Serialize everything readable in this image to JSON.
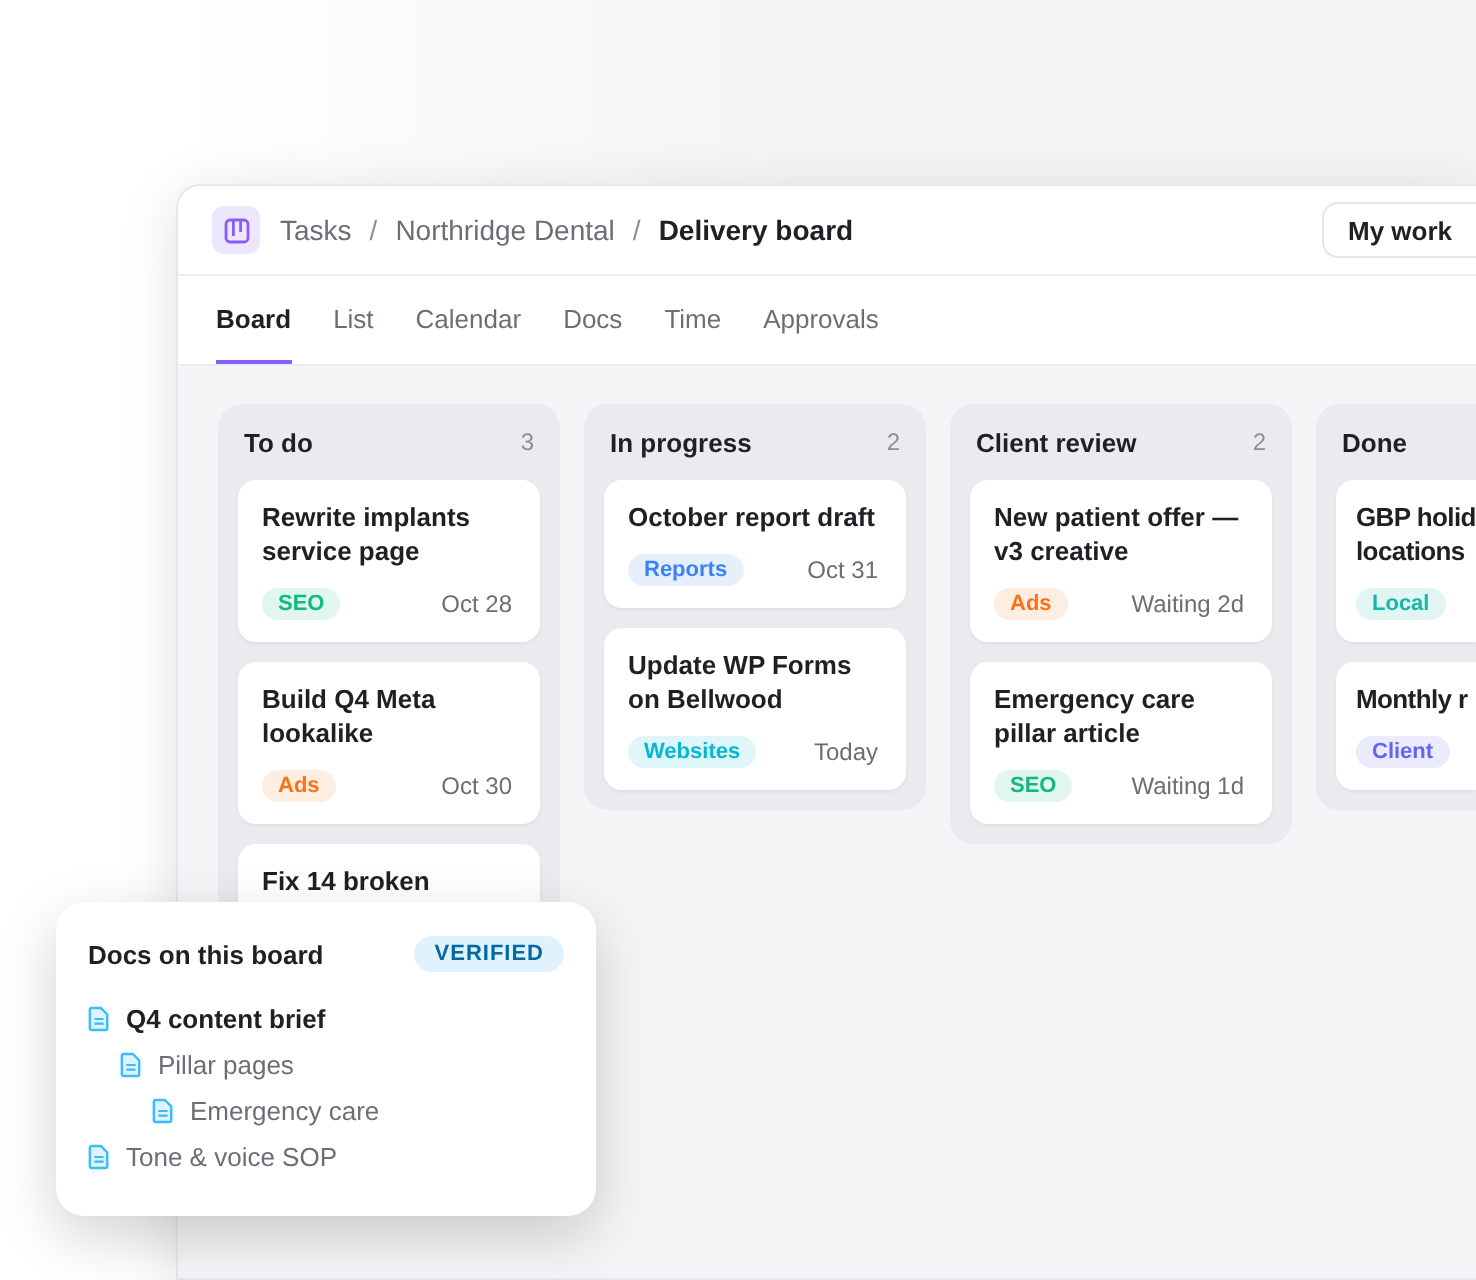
{
  "header": {
    "breadcrumb": [
      "Tasks",
      "Northridge Dental"
    ],
    "separator": "/",
    "current": "Delivery board",
    "button": "My work"
  },
  "tabs": [
    {
      "label": "Board",
      "selected": true
    },
    {
      "label": "List",
      "selected": false
    },
    {
      "label": "Calendar",
      "selected": false
    },
    {
      "label": "Docs",
      "selected": false
    },
    {
      "label": "Time",
      "selected": false
    },
    {
      "label": "Approvals",
      "selected": false
    }
  ],
  "columns": [
    {
      "title": "To do",
      "count": "3",
      "cards": [
        {
          "title": "Rewrite implants service page",
          "tag": {
            "label": "SEO",
            "color": "#10b981"
          },
          "due": "Oct 28"
        },
        {
          "title": "Build Q4 Meta lookalike",
          "tag": {
            "label": "Ads",
            "color": "#f97316"
          },
          "due": "Oct 30"
        },
        {
          "title": "Fix 14 broken"
        }
      ]
    },
    {
      "title": "In progress",
      "count": "2",
      "cards": [
        {
          "title": "October report draft",
          "tag": {
            "label": "Reports",
            "color": "#3b82f6"
          },
          "due": "Oct 31"
        },
        {
          "title": "Update WP Forms on Bellwood",
          "tag": {
            "label": "Websites",
            "color": "#06b6d4"
          },
          "due": "Today"
        }
      ]
    },
    {
      "title": "Client review",
      "count": "2",
      "cards": [
        {
          "title": "New patient offer — v3 creative",
          "tag": {
            "label": "Ads",
            "color": "#f97316"
          },
          "due": "Waiting 2d"
        },
        {
          "title": "Emergency care pillar article",
          "tag": {
            "label": "SEO",
            "color": "#10b981"
          },
          "due": "Waiting 1d"
        }
      ]
    },
    {
      "title": "Done",
      "cards": [
        {
          "title": "GBP holid\nlocations",
          "tag": {
            "label": "Local",
            "color": "#14b8a6"
          }
        },
        {
          "title": "Monthly r",
          "tag": {
            "label": "Client",
            "color": "#6366f1"
          }
        }
      ]
    }
  ],
  "docs_panel": {
    "title": "Docs on this board",
    "badge": "VERIFIED",
    "docs": [
      {
        "label": "Q4 content brief",
        "selected": true,
        "children": [
          {
            "label": "Pillar pages",
            "selected": false,
            "children": [
              {
                "label": "Emergency care",
                "selected": false
              }
            ]
          }
        ]
      },
      {
        "label": "Tone & voice SOP",
        "selected": false
      }
    ]
  }
}
